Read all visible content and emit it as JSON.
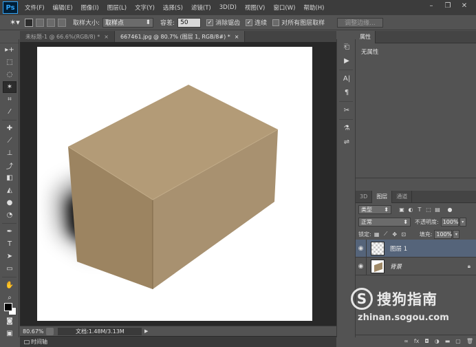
{
  "app": {
    "logo": "Ps"
  },
  "menu": [
    "文件(F)",
    "编辑(E)",
    "图像(I)",
    "图层(L)",
    "文字(Y)",
    "选择(S)",
    "滤镜(T)",
    "3D(D)",
    "视图(V)",
    "窗口(W)",
    "帮助(H)"
  ],
  "window_controls": {
    "minimize": "–",
    "restore": "❐",
    "close": "✕"
  },
  "options": {
    "tool_icon": "magic-wand-icon",
    "sample_size_label": "取样大小:",
    "sample_size_value": "取样点",
    "tolerance_label": "容差:",
    "tolerance_value": "50",
    "antialias_label": "消除锯齿",
    "antialias_checked": true,
    "contiguous_label": "连续",
    "contiguous_checked": true,
    "all_layers_label": "对所有图层取样",
    "all_layers_checked": false,
    "refine_edge_label": "调整边缘..."
  },
  "tabs": [
    {
      "label": "未标题-1 @ 66.6%(RGB/8) *",
      "active": false
    },
    {
      "label": "667461.jpg @ 80.7% (图层 1, RGB/8#) *",
      "active": true
    }
  ],
  "status": {
    "zoom": "80.67%",
    "doc_info": "文档:1.48M/3.13M",
    "timeline": "时间轴"
  },
  "properties_panel": {
    "tab": "属性",
    "content": "无属性"
  },
  "layers_panel": {
    "tabs": [
      "3D",
      "图层",
      "通道"
    ],
    "active_tab": "图层",
    "filter_label": "类型",
    "blend_mode": "正常",
    "opacity_label": "不透明度:",
    "opacity_value": "100%",
    "lock_label": "锁定:",
    "fill_label": "填充:",
    "fill_value": "100%",
    "layers": [
      {
        "name": "图层 1",
        "selected": true,
        "locked": false
      },
      {
        "name": "背景",
        "selected": false,
        "locked": true
      }
    ],
    "footer_icons": [
      "link-icon",
      "fx-icon",
      "mask-icon",
      "adjustment-icon",
      "folder-icon",
      "new-layer-icon",
      "trash-icon"
    ]
  },
  "watermark": {
    "logo_letter": "S",
    "title": "搜狗指南",
    "url": "zhinan.sogou.com"
  },
  "colors": {
    "menubar": "#3c3c3c",
    "ui_gray": "#535353",
    "workspace": "#282828",
    "selected_layer": "#55647a",
    "box_tan": "#a08a68"
  }
}
